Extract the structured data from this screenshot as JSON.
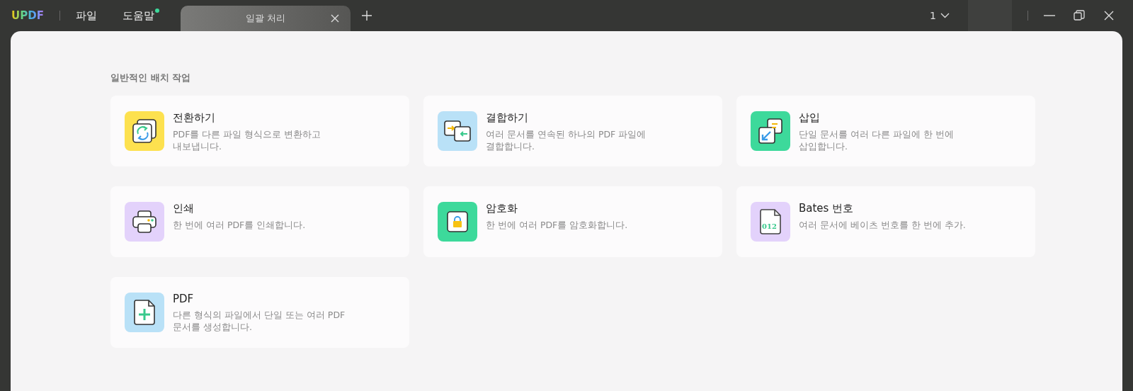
{
  "app": {
    "logo": "UPDF"
  },
  "menu": [
    {
      "label": "파일",
      "notification": false
    },
    {
      "label": "도움말",
      "notification": true
    }
  ],
  "tabs": [
    {
      "label": "일괄 처리",
      "selected": true
    }
  ],
  "page_selector": {
    "value": "1"
  },
  "section": {
    "title": "일반적인 배치 작업"
  },
  "tools": [
    {
      "kind": "convert",
      "color": "#fde14f",
      "title": "전환하기",
      "description": "PDF를 다른 파일 형식으로 변환하고\n내보냅니다."
    },
    {
      "kind": "combine",
      "color": "#b9e1f7",
      "title": "결합하기",
      "description": "여러 문서를 연속된 하나의 PDF 파일에\n결합합니다."
    },
    {
      "kind": "insert",
      "color": "#3dd99b",
      "title": "삽입",
      "description": "단일 문서를 여러 다른 파일에 한 번에\n삽입합니다."
    },
    {
      "kind": "print",
      "color": "#e3d2fb",
      "title": "인쇄",
      "description": "한 번에 여러 PDF를 인쇄합니다."
    },
    {
      "kind": "encrypt",
      "color": "#3dd99b",
      "title": "암호화",
      "description": "한 번에 여러 PDF를 암호화합니다."
    },
    {
      "kind": "bates",
      "color": "#e3d2fb",
      "title": "Bates 번호",
      "description": "여러 문서에 베이츠 번호를 한 번에 추가.",
      "icon_text": "012"
    },
    {
      "kind": "create",
      "color": "#b9e1f7",
      "title": "PDF",
      "description": "다른 형식의 파일에서 단일 또는 여러 PDF\n문서를 생성합니다."
    }
  ]
}
